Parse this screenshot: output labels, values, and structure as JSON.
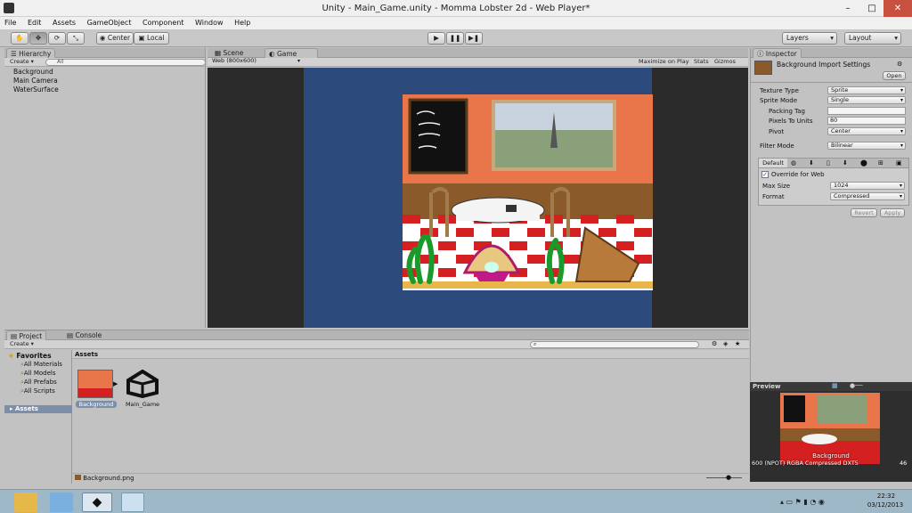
{
  "window": {
    "title": "Unity - Main_Game.unity - Momma Lobster 2d - Web Player*",
    "minimize": "–",
    "maximize": "□",
    "close": "✕"
  },
  "menu": [
    "File",
    "Edit",
    "Assets",
    "GameObject",
    "Component",
    "Window",
    "Help"
  ],
  "toolbar": {
    "pivot": "Center",
    "space": "Local",
    "layers": "Layers",
    "layout": "Layout"
  },
  "hierarchy": {
    "tab": "Hierarchy",
    "create": "Create",
    "search_placeholder": "All",
    "items": [
      "Background",
      "Main Camera",
      "WaterSurface"
    ]
  },
  "view": {
    "scene_tab": "Scene",
    "game_tab": "Game",
    "resolution": "Web (800x600)",
    "maximize": "Maximize on Play",
    "stats": "Stats",
    "gizmos": "Gizmos"
  },
  "inspector": {
    "tab": "Inspector",
    "title": "Background Import Settings",
    "open": "Open",
    "texture_type_label": "Texture Type",
    "texture_type_value": "Sprite",
    "sprite_mode_label": "Sprite Mode",
    "sprite_mode_value": "Single",
    "packing_tag_label": "Packing Tag",
    "ppu_label": "Pixels To Units",
    "ppu_value": "80",
    "pivot_label": "Pivot",
    "pivot_value": "Center",
    "filter_label": "Filter Mode",
    "filter_value": "Bilinear",
    "default_tab": "Default",
    "override_label": "Override for Web",
    "override_checked": true,
    "max_size_label": "Max Size",
    "max_size_value": "1024",
    "format_label": "Format",
    "format_value": "Compressed",
    "revert": "Revert",
    "apply": "Apply"
  },
  "preview": {
    "label": "Preview",
    "name": "Background",
    "info": "600 (NPOT) RGBA Compressed DXT5",
    "info_tail": "46"
  },
  "project": {
    "tab": "Project",
    "console_tab": "Console",
    "create": "Create",
    "favorites_label": "Favorites",
    "favorites": [
      "All Materials",
      "All Models",
      "All Prefabs",
      "All Scripts"
    ],
    "assets_folder": "Assets",
    "breadcrumb": "Assets",
    "assets": [
      "Background",
      "Main_Game"
    ],
    "footer_file": "Background.png"
  },
  "clock": {
    "time": "22:32",
    "date": "03/12/2013"
  },
  "colors": {
    "game_bg": "#2c4a7c",
    "wall": "#e8764a",
    "floor": "#8b5a2b",
    "panel": "#c2c2c2",
    "selection": "#7d8fa8"
  }
}
